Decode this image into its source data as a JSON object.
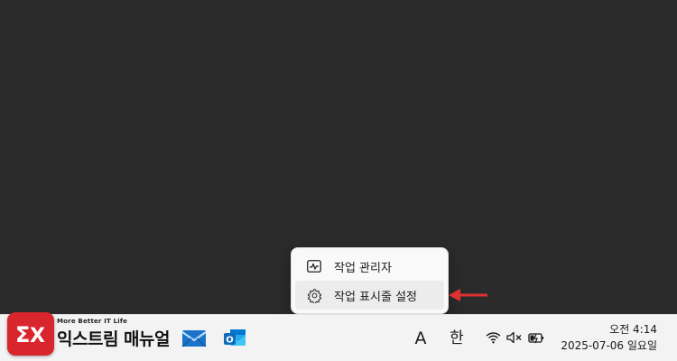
{
  "context_menu": {
    "items": [
      {
        "label": "작업 관리자",
        "icon": "task-manager-icon"
      },
      {
        "label": "작업 표시줄 설정",
        "icon": "gear-icon"
      }
    ]
  },
  "watermark": {
    "tagline": "More Better IT Life",
    "name": "익스트림 매뉴얼",
    "badge_color": "#d9262e"
  },
  "taskbar": {
    "apps": [
      {
        "name": "mail-icon"
      },
      {
        "name": "outlook-icon"
      }
    ],
    "input_mode_english": "A",
    "input_mode_korean": "한",
    "tray": [
      "wifi-icon",
      "volume-muted-icon",
      "battery-charging-icon"
    ],
    "clock": {
      "time": "오전 4:14",
      "date": "2025-07-06 일요일"
    }
  },
  "annotation": {
    "color": "#e03030"
  }
}
